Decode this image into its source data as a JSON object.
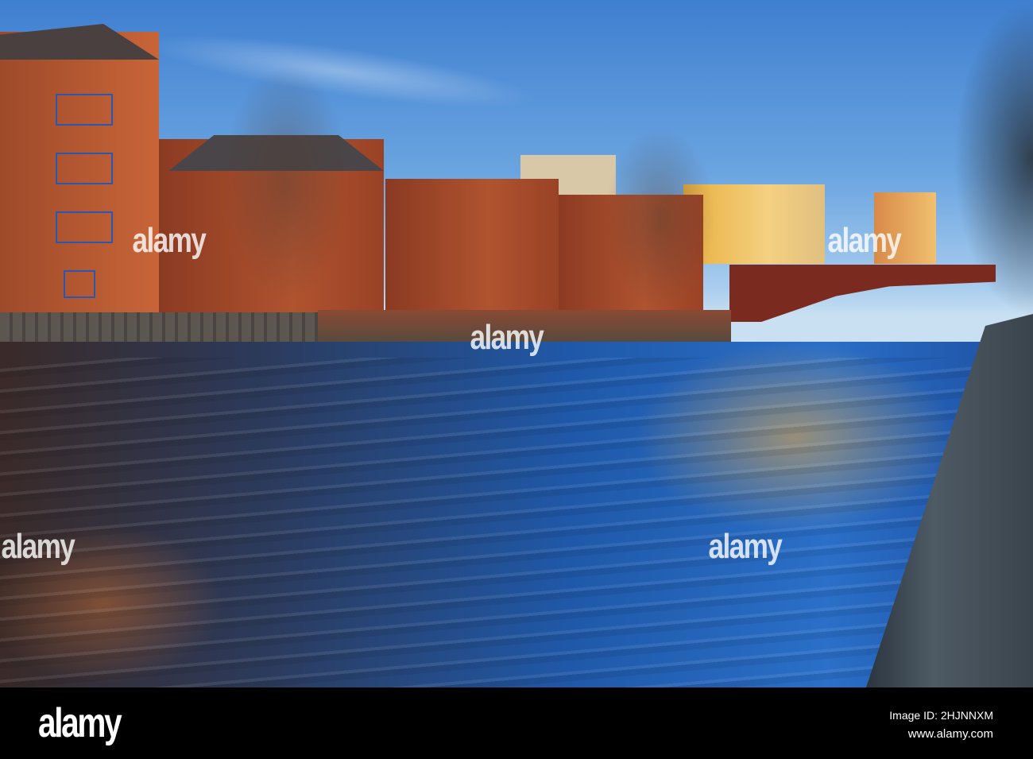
{
  "watermark": "alamy",
  "footer": {
    "logo": "alamy",
    "image_id": "Image ID: 2HJNNXM",
    "website": "www.alamy.com"
  },
  "colors": {
    "sky": "#3f7fd0",
    "brick": "#b0532f",
    "water": "#1f58a8",
    "bridge": "#7a2a1e"
  }
}
